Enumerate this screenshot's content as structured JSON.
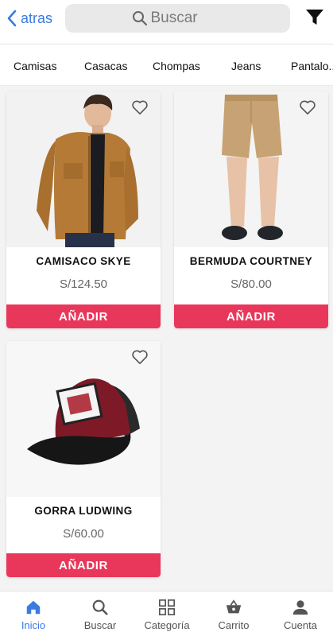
{
  "header": {
    "back_label": "atras",
    "search_placeholder": "Buscar"
  },
  "categories": [
    "Camisas",
    "Casacas",
    "Chompas",
    "Jeans",
    "Pantalo..."
  ],
  "products": [
    {
      "name": "CAMISACO SKYE",
      "price": "S/124.50",
      "add_label": "AÑADIR"
    },
    {
      "name": "BERMUDA COURTNEY",
      "price": "S/80.00",
      "add_label": "AÑADIR"
    },
    {
      "name": "GORRA LUDWING",
      "price": "S/60.00",
      "add_label": "AÑADIR"
    }
  ],
  "nav": {
    "items": [
      {
        "label": "Inicio",
        "icon": "home-icon",
        "active": true
      },
      {
        "label": "Buscar",
        "icon": "search-icon",
        "active": false
      },
      {
        "label": "Categoría",
        "icon": "grid-icon",
        "active": false
      },
      {
        "label": "Carrito",
        "icon": "basket-icon",
        "active": false
      },
      {
        "label": "Cuenta",
        "icon": "user-icon",
        "active": false
      }
    ]
  },
  "colors": {
    "accent": "#3b7be0",
    "add_button": "#e8375b"
  }
}
